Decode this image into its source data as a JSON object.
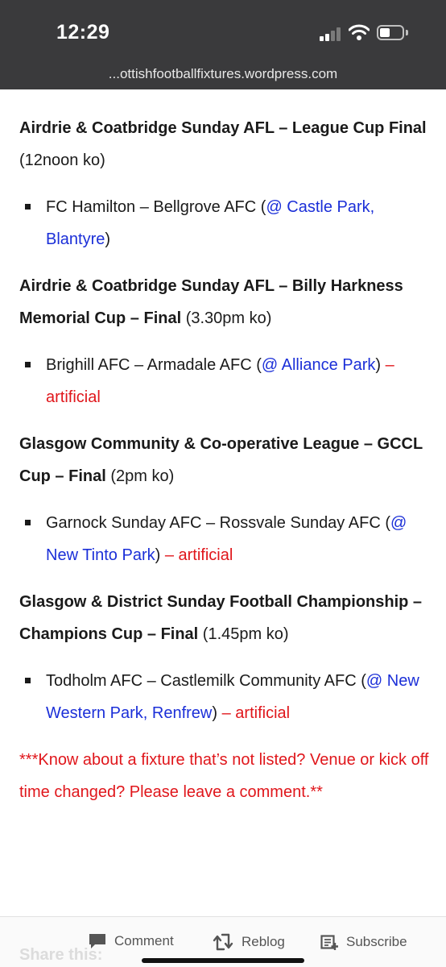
{
  "status_bar": {
    "time": "12:29",
    "signal_bars": 2,
    "battery_level_fraction": 0.45
  },
  "browser": {
    "url": "...ottishfootballfixtures.wordpress.com"
  },
  "colors": {
    "venue_link": "#1b2fd8",
    "artificial": "#e0161b",
    "top_bar": "#3a3a3c"
  },
  "competitions": [
    {
      "title": "Airdrie & Coatbridge Sunday AFL – League Cup Final",
      "ko": " (12noon ko)",
      "fixture": {
        "teams": "FC Hamilton – Bellgrove AFC ",
        "open": "(",
        "venue": "@ Castle Park, Blantyre",
        "close": ")",
        "surface": ""
      }
    },
    {
      "title": "Airdrie & Coatbridge Sunday AFL – Billy Harkness Memorial Cup – Final",
      "ko": " (3.30pm ko)",
      "fixture": {
        "teams": "Brighill AFC – Armadale AFC ",
        "open": "(",
        "venue": "@ Alliance Park",
        "close": ")",
        "surface": " – artificial"
      }
    },
    {
      "title": "Glasgow Community & Co-operative League – GCCL Cup – Final",
      "ko": " (2pm ko)",
      "fixture": {
        "teams": "Garnock Sunday AFC – Rossvale Sunday AFC ",
        "open": "(",
        "venue": "@ New Tinto Park",
        "close": ")",
        "surface": " – artificial"
      }
    },
    {
      "title": "Glasgow & District Sunday Football Championship – Champions Cup – Final",
      "ko": " (1.45pm ko)",
      "fixture": {
        "teams": "Todholm AFC – Castlemilk Community AFC ",
        "open": "(",
        "venue": "@ New Western Park, Renfrew",
        "close": ")",
        "surface": " – artificial"
      }
    }
  ],
  "notice": "***Know about a fixture that’s not listed? Venue or kick off time changed? Please leave a comment.**",
  "share_heading": "Share this:",
  "actions": {
    "comment": "Comment",
    "reblog": "Reblog",
    "subscribe": "Subscribe"
  }
}
